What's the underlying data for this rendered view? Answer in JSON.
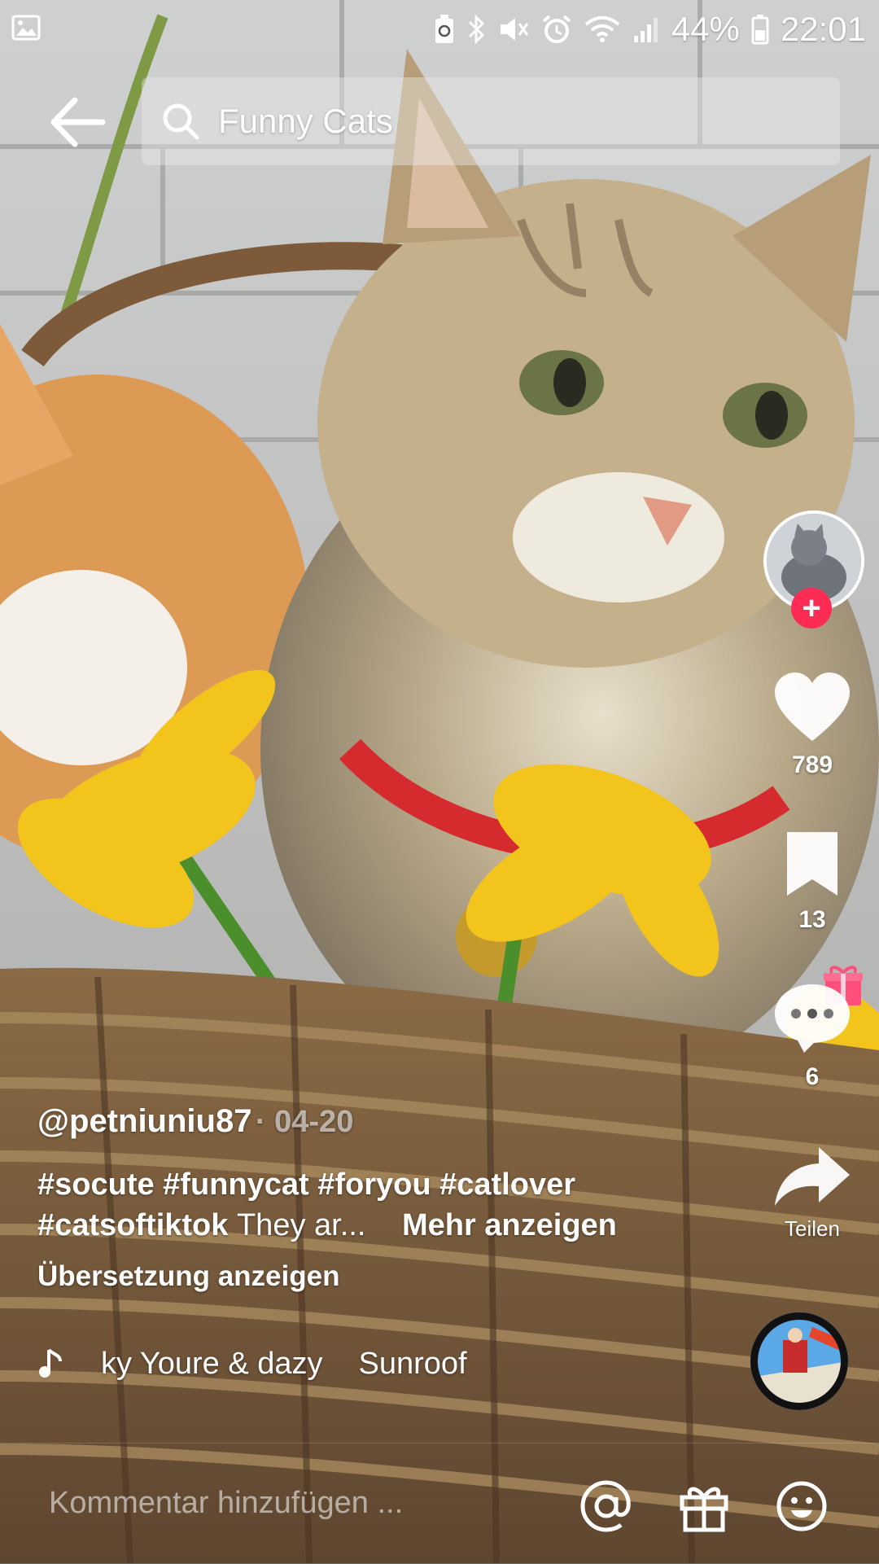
{
  "status_bar": {
    "icons": [
      "gallery-icon",
      "recycle-icon",
      "bluetooth-icon",
      "mute-icon",
      "alarm-icon",
      "wifi-icon",
      "signal-icon",
      "battery-icon"
    ],
    "battery": "44%",
    "time": "22:01"
  },
  "search": {
    "query": "Funny Cats"
  },
  "actions": {
    "likes": "789",
    "saves": "13",
    "comments": "6",
    "share_label": "Teilen"
  },
  "post": {
    "username": "@petniuniu87",
    "date": "· 04-20",
    "hashtags_line1": "#socute #funnycat #foryou #catlover",
    "hashtags_line2": "#catsoftiktok",
    "caption_tail": "They ar...",
    "more_label": "Mehr anzeigen",
    "translate_label": "Übersetzung anzeigen"
  },
  "music": {
    "track_part1": "ky Youre & dazy",
    "track_part2": "Sunroof"
  },
  "bottom_bar": {
    "comment_placeholder": "Kommentar hinzufügen ..."
  },
  "colors": {
    "accent": "#fe2c55",
    "gift": "#ff4f7a"
  }
}
